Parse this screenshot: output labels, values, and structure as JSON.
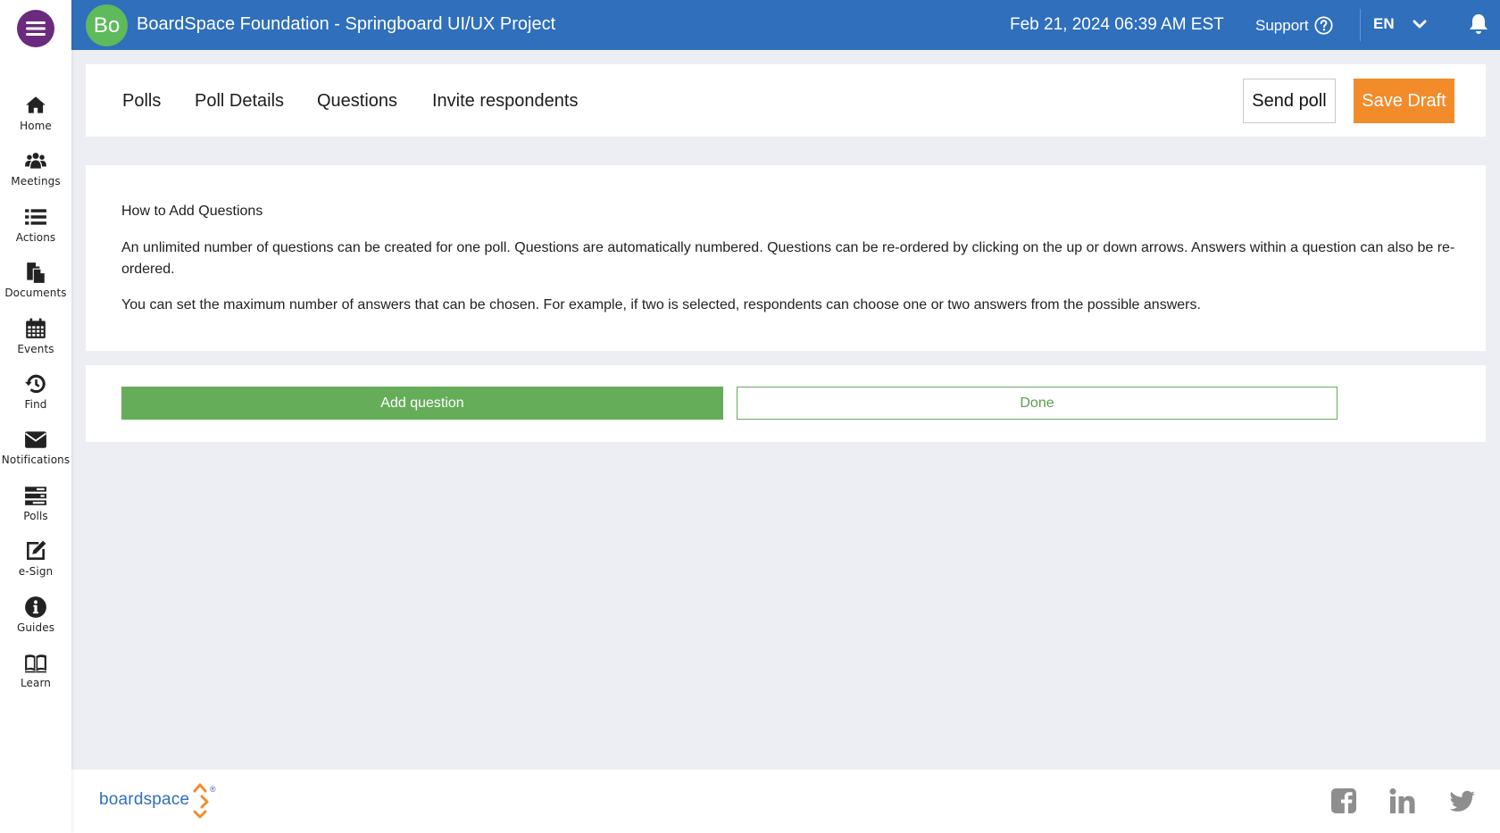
{
  "header": {
    "avatar_initials": "Bo",
    "org_title": "BoardSpace Foundation - Springboard UI/UX Project",
    "datetime": "Feb 21, 2024 06:39 AM  EST",
    "support_label": "Support",
    "language": "EN"
  },
  "sidebar": {
    "items": [
      {
        "label": "Home",
        "icon": "home-icon"
      },
      {
        "label": "Meetings",
        "icon": "people-icon"
      },
      {
        "label": "Actions",
        "icon": "list-icon"
      },
      {
        "label": "Documents",
        "icon": "documents-icon"
      },
      {
        "label": "Events",
        "icon": "calendar-icon"
      },
      {
        "label": "Find",
        "icon": "history-icon"
      },
      {
        "label": "Notifications",
        "icon": "envelope-icon"
      },
      {
        "label": "Polls",
        "icon": "polls-icon"
      },
      {
        "label": "e-Sign",
        "icon": "edit-icon"
      },
      {
        "label": "Guides",
        "icon": "info-icon"
      },
      {
        "label": "Learn",
        "icon": "book-icon"
      }
    ]
  },
  "tabs": [
    "Polls",
    "Poll Details",
    "Questions",
    "Invite respondents"
  ],
  "toolbar": {
    "send_label": "Send poll",
    "draft_label": "Save Draft"
  },
  "info": {
    "heading": "How to Add Questions",
    "p1": "An unlimited number of questions can be created for one poll. Questions are automatically numbered. Questions can be re-ordered by clicking on the up or down arrows. Answers within a question can also be re-ordered.",
    "p2": "You can set the maximum number of answers that can be chosen. For example, if two is selected, respondents can choose one or two answers from the possible answers."
  },
  "actions": {
    "add_label": "Add question",
    "done_label": "Done"
  },
  "footer": {
    "logo_text": "boardspace",
    "logo_mark": "®"
  },
  "colors": {
    "header": "#2f6fbc",
    "menu": "#6b2a7d",
    "avatar": "#5eba5b",
    "draft": "#f28c2b",
    "add": "#66ad5a"
  }
}
